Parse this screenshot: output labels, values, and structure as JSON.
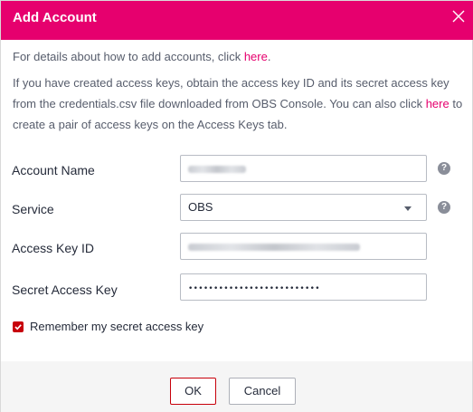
{
  "dialog": {
    "title": "Add Account",
    "close_icon": "close-icon"
  },
  "intro": {
    "line1_prefix": "For details about how to add accounts, click ",
    "line1_link": "here",
    "line1_suffix": ".",
    "line2_text": "If you have created access keys, obtain the access key ID and its secret access key from the credentials.csv file downloaded from OBS Console. You can also click ",
    "line2_link": "here",
    "line2_suffix": " to create a pair of access keys on the Access Keys tab."
  },
  "form": {
    "account_name_label": "Account Name",
    "account_name_value": "obs_test",
    "service_label": "Service",
    "service_value": "OBS",
    "access_key_id_label": "Access Key ID",
    "access_key_id_value": "PLNKTHRNHEBLBOBVXMG",
    "secret_access_key_label": "Secret Access Key",
    "secret_access_key_value": "••••••••••••••••••••••••••",
    "help_icon": "help-icon",
    "help_glyph": "?"
  },
  "remember": {
    "checked": true,
    "label": "Remember my secret access key"
  },
  "footer": {
    "ok_label": "OK",
    "cancel_label": "Cancel"
  },
  "colors": {
    "header": "#e6006e",
    "link": "#c7000b",
    "checkbox": "#c7000b",
    "footer_bg": "#f5f5f5"
  }
}
